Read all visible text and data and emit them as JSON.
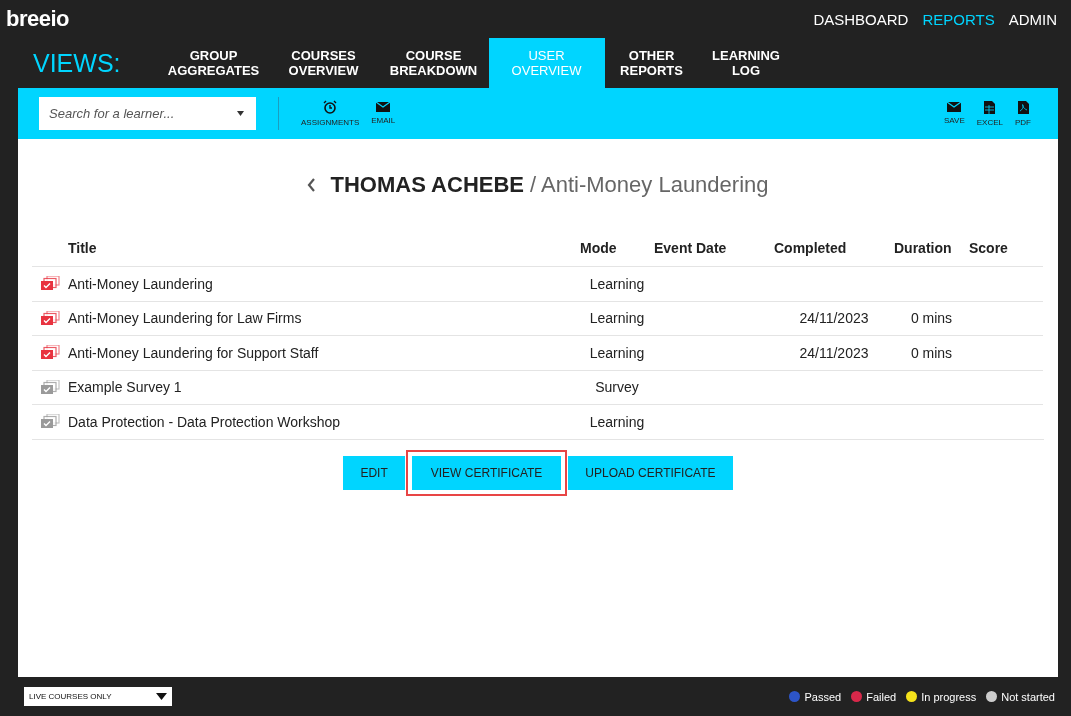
{
  "logo": "breeio",
  "top_nav": [
    {
      "label": "DASHBOARD",
      "selected": false
    },
    {
      "label": "REPORTS",
      "selected": true
    },
    {
      "label": "ADMIN",
      "selected": false
    }
  ],
  "views_label": "VIEWS:",
  "view_tabs": [
    {
      "label": "GROUP AGGREGATES",
      "selected": false
    },
    {
      "label": "COURSES OVERVIEW",
      "selected": false
    },
    {
      "label": "COURSE BREAKDOWN",
      "selected": false
    },
    {
      "label": "USER OVERVIEW",
      "selected": true
    },
    {
      "label": "OTHER REPORTS",
      "selected": false
    },
    {
      "label": "LEARNING LOG",
      "selected": false
    }
  ],
  "toolbar": {
    "search": {
      "placeholder": "Search for a learner..."
    },
    "left_actions": [
      {
        "kind": "alarm",
        "label": "ASSIGNMENTS"
      },
      {
        "kind": "mail",
        "label": "EMAIL"
      }
    ],
    "right_actions": [
      {
        "kind": "mail",
        "label": "SAVE"
      },
      {
        "kind": "sheet",
        "label": "EXCEL"
      },
      {
        "kind": "pdf",
        "label": "PDF"
      }
    ]
  },
  "heading": {
    "learner": "THOMAS ACHEBE",
    "course": "/ Anti-Money Laundering"
  },
  "table": {
    "columns": [
      "Title",
      "Mode",
      "Event Date",
      "Completed",
      "Duration",
      "Score"
    ],
    "rows": [
      {
        "color": "#e8323f",
        "title": "Anti-Money Laundering",
        "mode": "Learning"
      },
      {
        "color": "#e8323f",
        "title": "Anti-Money Laundering for Law Firms",
        "mode": "Learning",
        "completed": "24/11/2023",
        "duration": "0 mins"
      },
      {
        "color": "#e8323f",
        "title": "Anti-Money Laundering for Support Staff",
        "mode": "Learning",
        "completed": "24/11/2023",
        "duration": "0 mins"
      },
      {
        "color": "#9a9a9a",
        "title": "Example Survey 1",
        "mode": "Survey"
      },
      {
        "color": "#9a9a9a",
        "title": "Data Protection - Data Protection Workshop",
        "mode": "Learning"
      }
    ]
  },
  "buttons": [
    {
      "label": "EDIT",
      "highlighted": false
    },
    {
      "label": "VIEW CERTIFICATE",
      "highlighted": true
    },
    {
      "label": "UPLOAD CERTIFICATE",
      "highlighted": false
    }
  ],
  "filter": {
    "value": "LIVE COURSES ONLY"
  },
  "legend": [
    {
      "label": "Passed",
      "color": "#2d55c8"
    },
    {
      "label": "Failed",
      "color": "#d8284a"
    },
    {
      "label": "In progress",
      "color": "#f5e21b"
    },
    {
      "label": "Not started",
      "color": "#cccccc"
    }
  ]
}
